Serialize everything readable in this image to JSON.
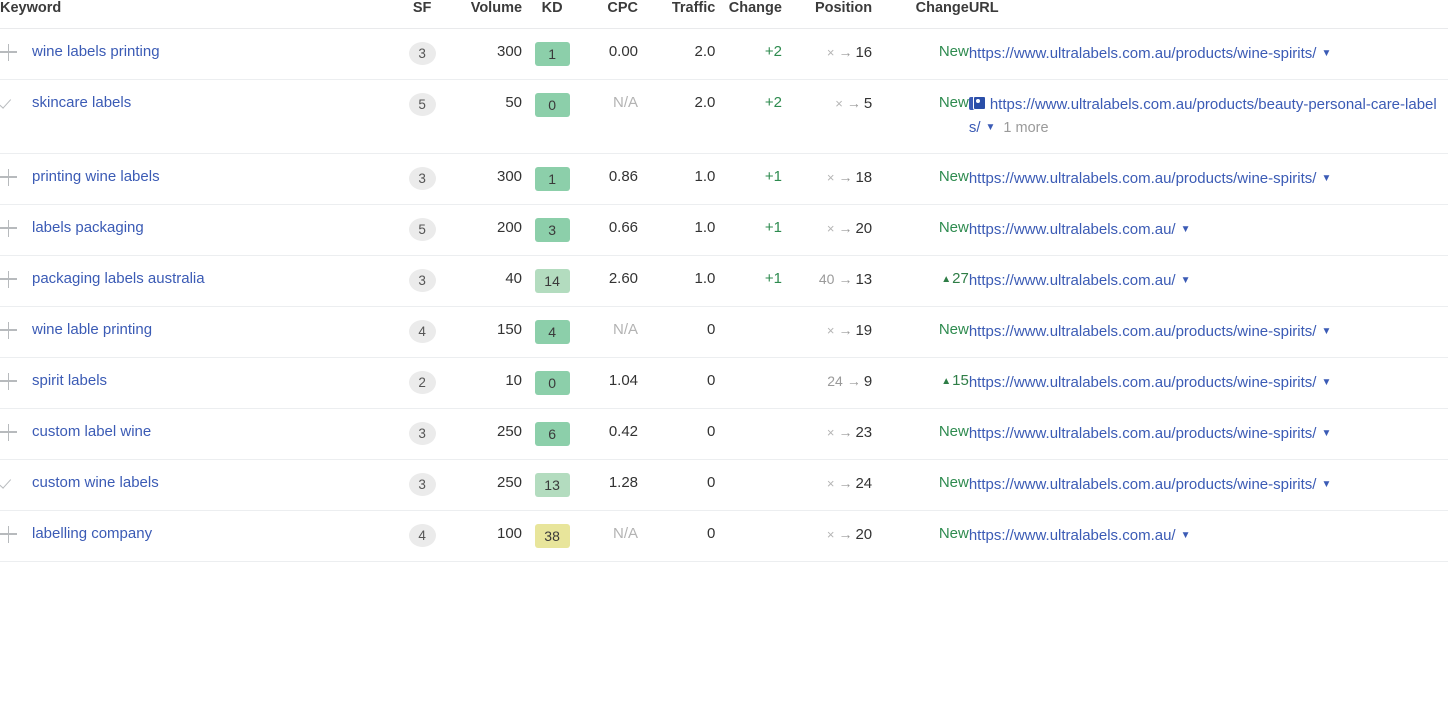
{
  "table": {
    "columns": [
      {
        "key": "keyword",
        "label": "Keyword"
      },
      {
        "key": "sf",
        "label": "SF"
      },
      {
        "key": "volume",
        "label": "Volume"
      },
      {
        "key": "kd",
        "label": "KD"
      },
      {
        "key": "cpc",
        "label": "CPC"
      },
      {
        "key": "traffic",
        "label": "Traffic"
      },
      {
        "key": "change1",
        "label": "Change"
      },
      {
        "key": "position",
        "label": "Position"
      },
      {
        "key": "change2",
        "label": "Change"
      },
      {
        "key": "url",
        "label": "URL"
      }
    ],
    "colors": {
      "link": "#3b5bb5",
      "positive": "#2e8b4f",
      "kd_low": "#8ccfaa",
      "kd_mid": "#b3dcbf",
      "kd_high": "#e8e59b",
      "muted": "#b3b3b3",
      "sf_pill_bg": "#ebebeb",
      "row_border": "#eceef0"
    },
    "rows": [
      {
        "mark_icon": "plus-icon",
        "keyword": "wine labels printing",
        "sf": "3",
        "volume": "300",
        "kd": "1",
        "kd_color": "#8ccfaa",
        "cpc": "0.00",
        "cpc_na": false,
        "traffic": "2.0",
        "change1": "+2",
        "position_old": "×",
        "position_old_none": true,
        "position_arrow": "→",
        "position_new": "16",
        "change2": "New",
        "change2_type": "new",
        "url": "https://www.ultralabels.com.au/products/wine-spirits/",
        "url_serp_icon": false,
        "url_caret": "▼",
        "url_more": ""
      },
      {
        "mark_icon": "check-icon",
        "keyword": "skincare labels",
        "sf": "5",
        "volume": "50",
        "kd": "0",
        "kd_color": "#8ccfaa",
        "cpc": "N/A",
        "cpc_na": true,
        "traffic": "2.0",
        "change1": "+2",
        "position_old": "×",
        "position_old_none": true,
        "position_arrow": "→",
        "position_new": "5",
        "change2": "New",
        "change2_type": "new",
        "url": "https://www.ultralabels.com.au/products/beauty-personal-care-labels/",
        "url_serp_icon": true,
        "url_caret": "▼",
        "url_more": "1 more"
      },
      {
        "mark_icon": "plus-icon",
        "keyword": "printing wine labels",
        "sf": "3",
        "volume": "300",
        "kd": "1",
        "kd_color": "#8ccfaa",
        "cpc": "0.86",
        "cpc_na": false,
        "traffic": "1.0",
        "change1": "+1",
        "position_old": "×",
        "position_old_none": true,
        "position_arrow": "→",
        "position_new": "18",
        "change2": "New",
        "change2_type": "new",
        "url": "https://www.ultralabels.com.au/products/wine-spirits/",
        "url_serp_icon": false,
        "url_caret": "▼",
        "url_more": ""
      },
      {
        "mark_icon": "plus-icon",
        "keyword": "labels packaging",
        "sf": "5",
        "volume": "200",
        "kd": "3",
        "kd_color": "#8ccfaa",
        "cpc": "0.66",
        "cpc_na": false,
        "traffic": "1.0",
        "change1": "+1",
        "position_old": "×",
        "position_old_none": true,
        "position_arrow": "→",
        "position_new": "20",
        "change2": "New",
        "change2_type": "new",
        "url": "https://www.ultralabels.com.au/",
        "url_serp_icon": false,
        "url_caret": "▼",
        "url_more": ""
      },
      {
        "mark_icon": "plus-icon",
        "keyword": "packaging labels australia",
        "sf": "3",
        "volume": "40",
        "kd": "14",
        "kd_color": "#b3dcbf",
        "cpc": "2.60",
        "cpc_na": false,
        "traffic": "1.0",
        "change1": "+1",
        "position_old": "40",
        "position_old_none": false,
        "position_arrow": "→",
        "position_new": "13",
        "change2": "27",
        "change2_type": "up",
        "url": "https://www.ultralabels.com.au/",
        "url_serp_icon": false,
        "url_caret": "▼",
        "url_more": ""
      },
      {
        "mark_icon": "plus-icon",
        "keyword": "wine lable printing",
        "sf": "4",
        "volume": "150",
        "kd": "4",
        "kd_color": "#8ccfaa",
        "cpc": "N/A",
        "cpc_na": true,
        "traffic": "0",
        "change1": "",
        "position_old": "×",
        "position_old_none": true,
        "position_arrow": "→",
        "position_new": "19",
        "change2": "New",
        "change2_type": "new",
        "url": "https://www.ultralabels.com.au/products/wine-spirits/",
        "url_serp_icon": false,
        "url_caret": "▼",
        "url_more": ""
      },
      {
        "mark_icon": "plus-icon",
        "keyword": "spirit labels",
        "sf": "2",
        "volume": "10",
        "kd": "0",
        "kd_color": "#8ccfaa",
        "cpc": "1.04",
        "cpc_na": false,
        "traffic": "0",
        "change1": "",
        "position_old": "24",
        "position_old_none": false,
        "position_arrow": "→",
        "position_new": "9",
        "change2": "15",
        "change2_type": "up",
        "url": "https://www.ultralabels.com.au/products/wine-spirits/",
        "url_serp_icon": false,
        "url_caret": "▼",
        "url_more": ""
      },
      {
        "mark_icon": "plus-icon",
        "keyword": "custom label wine",
        "sf": "3",
        "volume": "250",
        "kd": "6",
        "kd_color": "#8ccfaa",
        "cpc": "0.42",
        "cpc_na": false,
        "traffic": "0",
        "change1": "",
        "position_old": "×",
        "position_old_none": true,
        "position_arrow": "→",
        "position_new": "23",
        "change2": "New",
        "change2_type": "new",
        "url": "https://www.ultralabels.com.au/products/wine-spirits/",
        "url_serp_icon": false,
        "url_caret": "▼",
        "url_more": ""
      },
      {
        "mark_icon": "check-icon",
        "keyword": "custom wine labels",
        "sf": "3",
        "volume": "250",
        "kd": "13",
        "kd_color": "#b3dcbf",
        "cpc": "1.28",
        "cpc_na": false,
        "traffic": "0",
        "change1": "",
        "position_old": "×",
        "position_old_none": true,
        "position_arrow": "→",
        "position_new": "24",
        "change2": "New",
        "change2_type": "new",
        "url": "https://www.ultralabels.com.au/products/wine-spirits/",
        "url_serp_icon": false,
        "url_caret": "▼",
        "url_more": ""
      },
      {
        "mark_icon": "plus-icon",
        "keyword": "labelling company",
        "sf": "4",
        "volume": "100",
        "kd": "38",
        "kd_color": "#e8e59b",
        "cpc": "N/A",
        "cpc_na": true,
        "traffic": "0",
        "change1": "",
        "position_old": "×",
        "position_old_none": true,
        "position_arrow": "→",
        "position_new": "20",
        "change2": "New",
        "change2_type": "new",
        "url": "https://www.ultralabels.com.au/",
        "url_serp_icon": false,
        "url_caret": "▼",
        "url_more": ""
      }
    ]
  }
}
